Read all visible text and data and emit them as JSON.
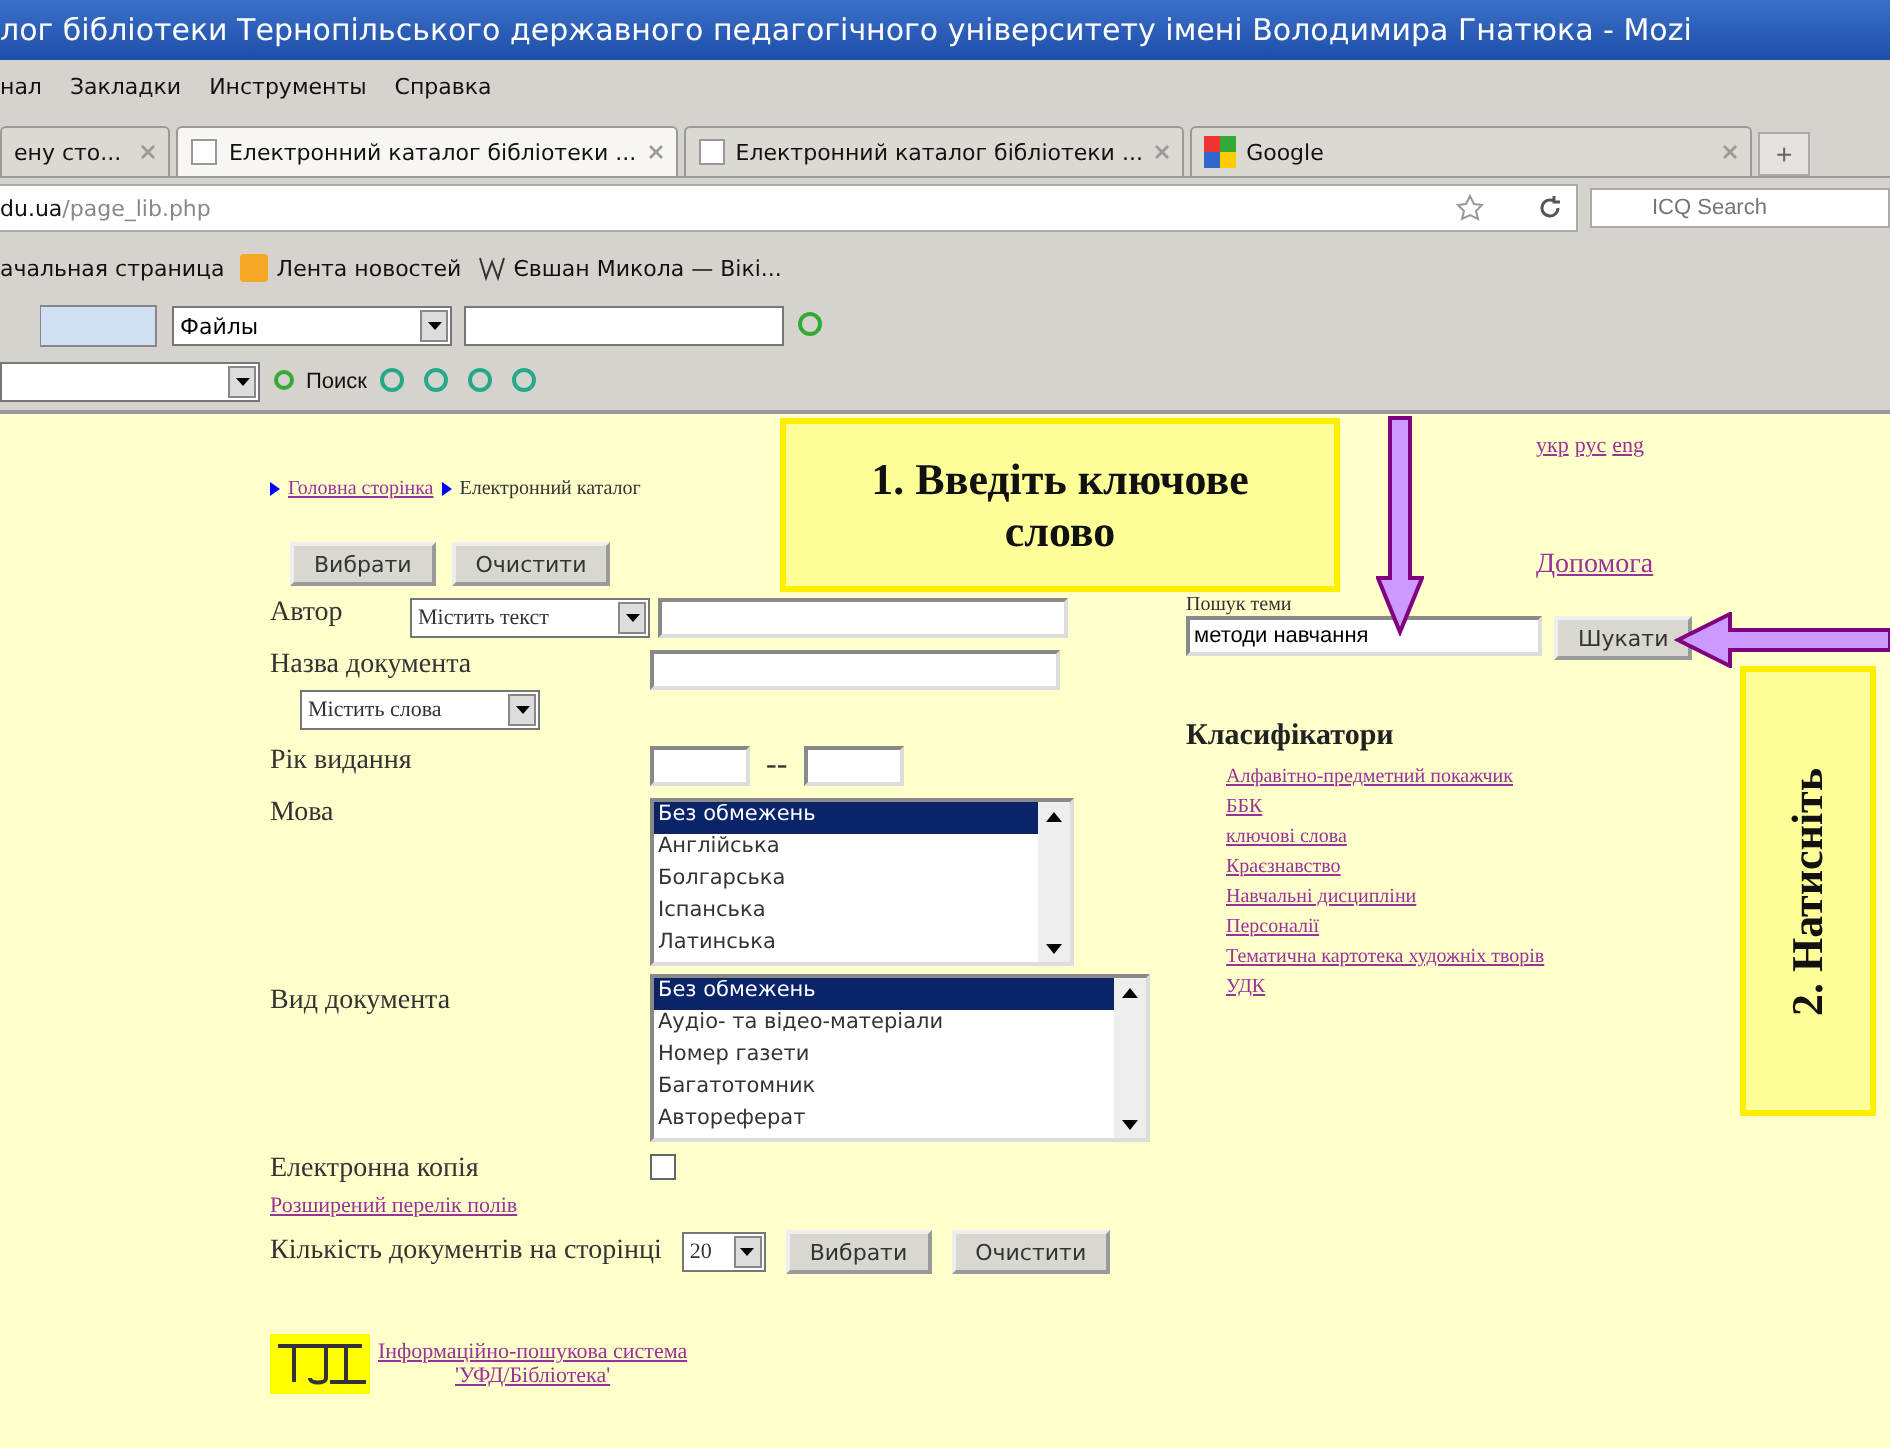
{
  "window": {
    "title": "лог бібліотеки Тернопільського державного педагогічного університету імені Володимира Гнатюка - Mozi"
  },
  "menu": [
    "нал",
    "Закладки",
    "Инструменты",
    "Справка"
  ],
  "tabs": [
    {
      "label": "ену сто...",
      "selected": false,
      "kind": "cut"
    },
    {
      "label": "Електронний каталог бібліотеки ...",
      "selected": true,
      "kind": "page"
    },
    {
      "label": "Електронний каталог бібліотеки ...",
      "selected": false,
      "kind": "page"
    },
    {
      "label": "Google",
      "selected": false,
      "kind": "google"
    }
  ],
  "new_tab": "+",
  "address": {
    "host": "du.ua",
    "path": "/page_lib.php"
  },
  "search_engine": {
    "placeholder": "ICQ Search"
  },
  "bookmarks": [
    {
      "label": "ачальная страница",
      "kind": "plain"
    },
    {
      "label": "Лента новостей",
      "kind": "feed"
    },
    {
      "label": "Євшан Микола — Вікі...",
      "kind": "wiki"
    }
  ],
  "toolbar": {
    "files_select": "Файлы",
    "search_button": "Поиск"
  },
  "page": {
    "breadcrumb": [
      {
        "label": "Головна сторінка",
        "kind": "link"
      },
      {
        "label": "Електронний каталог",
        "kind": "current"
      }
    ],
    "top_buttons": [
      "Вибрати",
      "Очистити"
    ],
    "author": {
      "label": "Автор",
      "mode": "Містить текст"
    },
    "doc_title": {
      "label": "Назва документа",
      "mode": "Містить слова"
    },
    "year": {
      "label": "Рік видання",
      "separator": "--"
    },
    "language": {
      "label": "Мова",
      "options": [
        {
          "label": "Без обмежень",
          "selected": true
        },
        {
          "label": "Англійська",
          "selected": false
        },
        {
          "label": "Болгарська",
          "selected": false
        },
        {
          "label": "Іспанська",
          "selected": false
        },
        {
          "label": "Латинська",
          "selected": false
        }
      ]
    },
    "doc_type": {
      "label": "Вид документа",
      "options": [
        {
          "label": "Без обмежень",
          "selected": true
        },
        {
          "label": "Аудіо- та відео-матеріали",
          "selected": false
        },
        {
          "label": "Номер газети",
          "selected": false
        },
        {
          "label": "Багатотомник",
          "selected": false
        },
        {
          "label": "Автореферат",
          "selected": false
        }
      ]
    },
    "electronic_copy": {
      "label": "Електронна копія",
      "checked": false
    },
    "extended_link": "Розширений перелік полів",
    "per_page": {
      "label": "Кількість документів на сторінці",
      "value": "20"
    },
    "bottom_buttons": [
      "Вибрати",
      "Очистити"
    ],
    "footer_link": [
      "Інформаційно-пошукова система",
      "'УФД/Бібліотека'"
    ],
    "languages": [
      "укр",
      "рус",
      "eng"
    ],
    "help": "Допомога",
    "topic_search": {
      "label": "Пошук теми",
      "value": "методи навчання",
      "button": "Шукати"
    },
    "classifiers": {
      "title": "Класифікатори",
      "items": [
        "Алфавітно-предметний покажчик",
        "ББК",
        "ключові слова",
        "Краєзнавство",
        "Навчальні дисципліни",
        "Персоналії",
        "Тематична картотека художніх творів",
        "УДК"
      ]
    }
  },
  "callouts": [
    {
      "text": "1. Введіть ключове слово",
      "kind": "horizontal"
    },
    {
      "text": "2. Натисніть",
      "kind": "vertical"
    }
  ]
}
